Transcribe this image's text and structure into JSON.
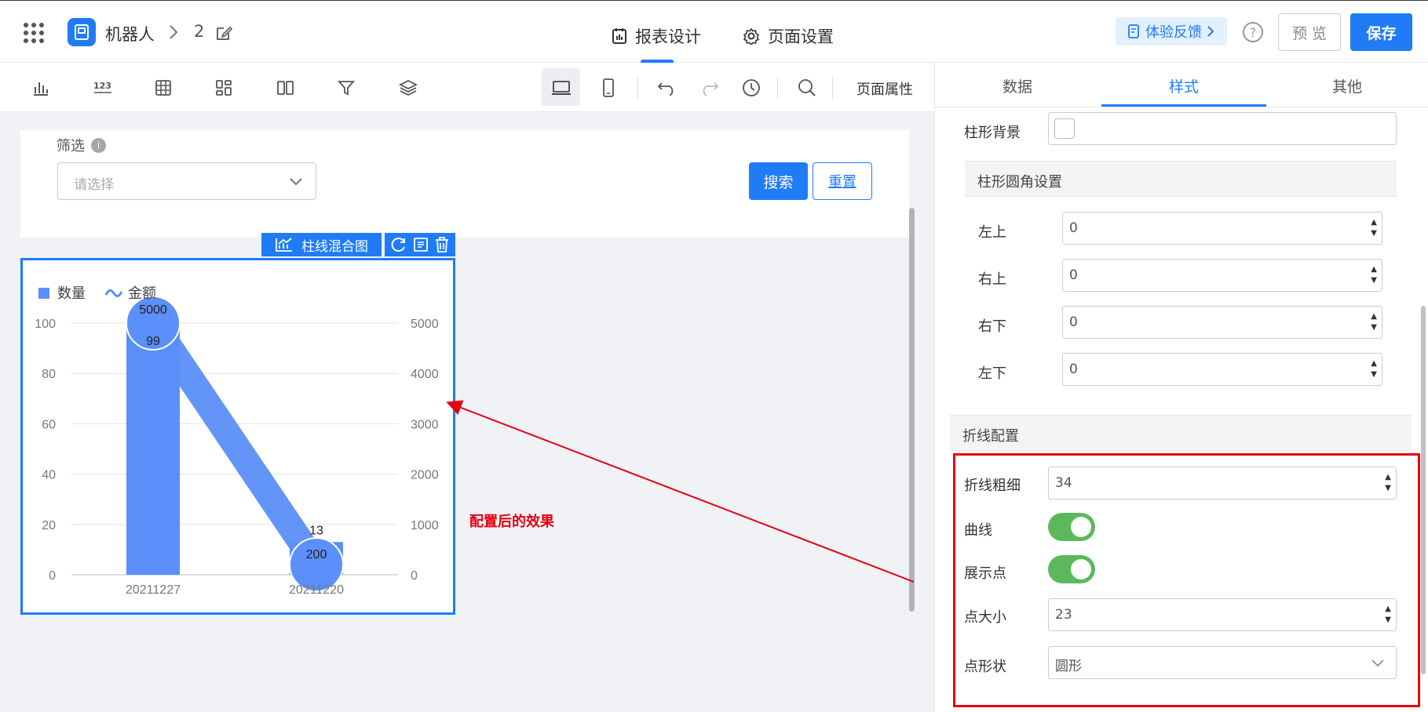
{
  "header": {
    "app_name": "机器人",
    "breadcrumb_num": "2",
    "tabs": [
      {
        "label": "报表设计",
        "icon": "report-icon"
      },
      {
        "label": "页面设置",
        "icon": "gear-icon"
      }
    ],
    "feedback_label": "体验反馈",
    "help_label": "?",
    "preview_label": "预 览",
    "save_label": "保存"
  },
  "toolbar": {
    "page_properties_label": "页面属性"
  },
  "filter": {
    "label": "筛选",
    "info": "i",
    "placeholder": "请选择",
    "search_label": "搜索",
    "reset_label": "重置"
  },
  "chart_widget": {
    "badge_label": "柱线混合图"
  },
  "chart_data": {
    "type": "bar",
    "categories": [
      "20211227",
      "20211220"
    ],
    "series": [
      {
        "name": "数量",
        "type": "bar",
        "axis": "left",
        "values": [
          99,
          13
        ],
        "color": "#5b8ff9"
      },
      {
        "name": "金额",
        "type": "line",
        "axis": "right",
        "values": [
          5000,
          200
        ],
        "color": "#5b8ff9"
      }
    ],
    "y_left": {
      "ticks": [
        "0",
        "20",
        "40",
        "60",
        "80",
        "100"
      ],
      "range": [
        0,
        100
      ]
    },
    "y_right": {
      "ticks": [
        "0",
        "1000",
        "2000",
        "3000",
        "4000",
        "5000"
      ],
      "range": [
        0,
        5000
      ]
    },
    "legend_position": "top-left",
    "grid": true,
    "bar_labels": [
      "99",
      "13"
    ],
    "line_labels": [
      "5000",
      "200"
    ]
  },
  "annotation": {
    "text": "配置后的效果",
    "color": "#e60012"
  },
  "panel": {
    "tabs": [
      {
        "label": "数据",
        "active": false
      },
      {
        "label": "样式",
        "active": true
      },
      {
        "label": "其他",
        "active": false
      }
    ],
    "bar_background_label": "柱形背景",
    "corner_section_title": "柱形圆角设置",
    "corners": [
      {
        "label": "左上",
        "value": "0"
      },
      {
        "label": "右上",
        "value": "0"
      },
      {
        "label": "右下",
        "value": "0"
      },
      {
        "label": "左下",
        "value": "0"
      }
    ],
    "line_section_title": "折线配置",
    "line_width_label": "折线粗细",
    "line_width_value": "34",
    "curve_label": "曲线",
    "curve_on": true,
    "show_points_label": "展示点",
    "show_points_on": true,
    "point_size_label": "点大小",
    "point_size_value": "23",
    "point_shape_label": "点形状",
    "point_shape_value": "圆形"
  },
  "colors": {
    "accent": "#1f7cf6",
    "toggle_on": "#5cb85c",
    "highlight": "#e60012"
  }
}
